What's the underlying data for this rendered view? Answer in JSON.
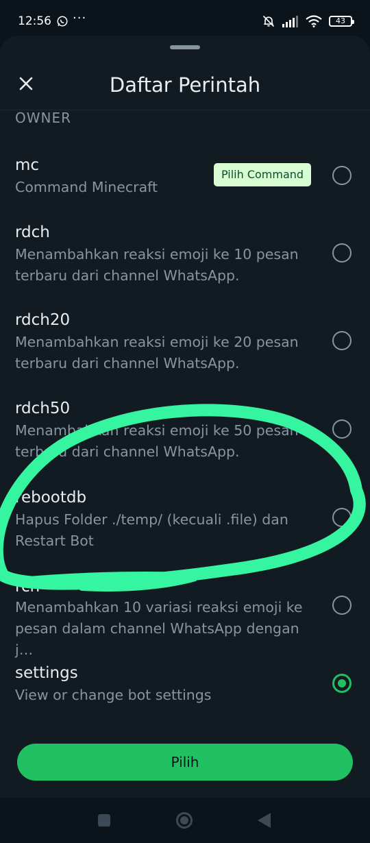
{
  "status_bar": {
    "time": "12:56",
    "more": "···",
    "battery": "43",
    "icons": [
      "whatsapp-icon",
      "mute-icon",
      "signal-icon",
      "wifi-icon",
      "battery-icon"
    ]
  },
  "sheet": {
    "title": "Daftar Perintah",
    "close_icon": "close-icon",
    "section_label": "OWNER",
    "tooltip": "Pilih Command",
    "commands": [
      {
        "name": "mc",
        "description": "Command Minecraft",
        "selected": false
      },
      {
        "name": "rdch",
        "description": "Menambahkan reaksi emoji ke 10 pesan terbaru dari channel WhatsApp.",
        "selected": false
      },
      {
        "name": "rdch20",
        "description": "Menambahkan reaksi emoji ke 20 pesan terbaru dari channel WhatsApp.",
        "selected": false
      },
      {
        "name": "rdch50",
        "description": "Menambahkan reaksi emoji ke 50 pesan terbaru dari channel WhatsApp.",
        "selected": false
      },
      {
        "name": "rebootdb",
        "description": "Hapus Folder ./temp/ (kecuali .file) dan Restart Bot",
        "selected": false
      },
      {
        "name": "rch",
        "description": "Menambahkan 10 variasi reaksi emoji ke pesan dalam channel WhatsApp dengan j…",
        "selected": false
      },
      {
        "name": "settings",
        "description": "View or change bot settings",
        "selected": true
      }
    ],
    "submit_label": "Pilih"
  },
  "colors": {
    "accent": "#21c063",
    "background": "#121b22",
    "annotation": "#35f5a0"
  }
}
